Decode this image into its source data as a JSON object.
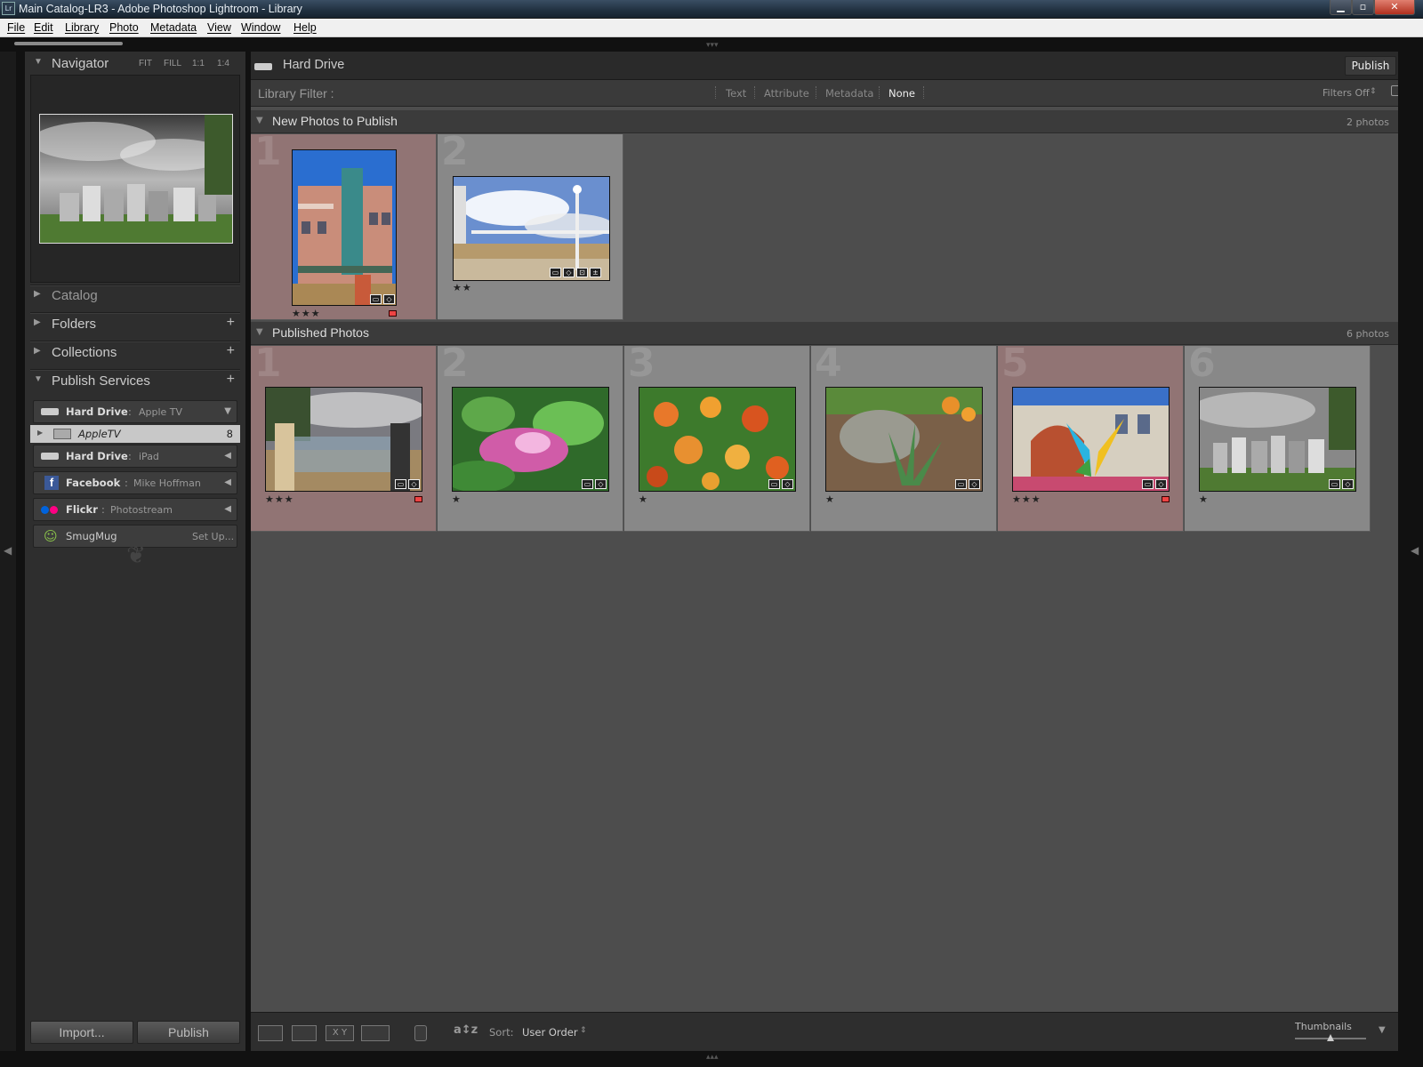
{
  "window": {
    "title": "Main Catalog-LR3 - Adobe Photoshop Lightroom - Library",
    "app_icon": "Lr"
  },
  "menu": [
    "File",
    "Edit",
    "Library",
    "Photo",
    "Metadata",
    "View",
    "Window",
    "Help"
  ],
  "left_panel": {
    "navigator": {
      "label": "Navigator",
      "options": [
        "FIT",
        "FILL",
        "1:1",
        "1:4"
      ]
    },
    "sections": [
      "Catalog",
      "Folders",
      "Collections",
      "Publish Services"
    ],
    "publish_services": [
      {
        "name": "Hard Drive",
        "sub": "Apple TV",
        "arrow": "▼",
        "color": "#cccccc"
      },
      {
        "name": "Hard Drive",
        "sub": "iPad",
        "arrow": "◀",
        "color": "#cccccc"
      },
      {
        "name": "Facebook",
        "sub": "Mike Hoffman",
        "arrow": "◀",
        "color": "#3b5998"
      },
      {
        "name": "Flickr",
        "sub": "Photostream",
        "arrow": "◀",
        "color": "#ff0084"
      },
      {
        "name": "SmugMug",
        "sub": "Set Up...",
        "arrow": "",
        "color": "#8bc34a"
      }
    ],
    "publish_child": {
      "label": "AppleTV",
      "count": "8"
    },
    "import_label": "Import...",
    "publish_label": "Publish"
  },
  "header": {
    "title": "Hard Drive",
    "publish_button": "Publish"
  },
  "filter": {
    "label": "Library Filter :",
    "options": [
      "Text",
      "Attribute",
      "Metadata",
      "None"
    ],
    "filters_off": "Filters Off"
  },
  "groups": [
    {
      "title": "New Photos to Publish",
      "count": "2 photos"
    },
    {
      "title": "Published Photos",
      "count": "6 photos"
    }
  ],
  "new_photos": [
    {
      "num": "1",
      "stars": "★★★",
      "selected": true,
      "flag": true
    },
    {
      "num": "2",
      "stars": "★★",
      "selected": false,
      "flag": false
    }
  ],
  "published_photos": [
    {
      "num": "1",
      "stars": "★★★",
      "selected": true,
      "flag": true
    },
    {
      "num": "2",
      "stars": "★",
      "selected": false,
      "flag": false
    },
    {
      "num": "3",
      "stars": "★",
      "selected": false,
      "flag": false
    },
    {
      "num": "4",
      "stars": "★",
      "selected": false,
      "flag": false
    },
    {
      "num": "5",
      "stars": "★★★",
      "selected": true,
      "flag": true
    },
    {
      "num": "6",
      "stars": "★",
      "selected": false,
      "flag": false
    }
  ],
  "toolbar": {
    "sort_label": "Sort:",
    "sort_value": "User Order",
    "thumbnails_label": "Thumbnails"
  }
}
